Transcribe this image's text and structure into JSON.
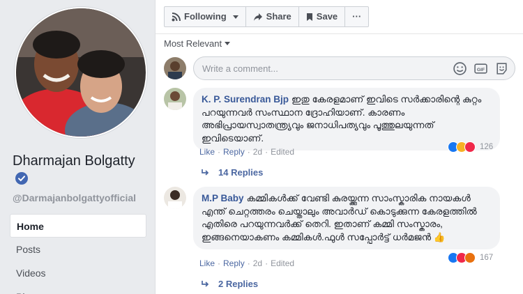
{
  "sidebar": {
    "page_name": "Dharmajan Bolgatty",
    "username": "@Darmajanbolgattyofficial",
    "nav": [
      "Home",
      "Posts",
      "Videos",
      "Ph..."
    ]
  },
  "actions": {
    "following": "Following",
    "share": "Share",
    "save": "Save",
    "more": "···"
  },
  "sort_label": "Most Relevant",
  "composer": {
    "placeholder": "Write a comment..."
  },
  "comments": [
    {
      "author": "K. P. Surendran Bjp",
      "text": "ഇതു കേരളമാണ് ഇവിടെ സർക്കാരിന്റെ കുറ്റം പറയുന്നവർ സംസ്ഥാന ദ്രോഹിയാണ്. കാരണം അഭിപ്രായസ്വാതന്ത്ര്യവും ജനാധിപത്യവും പൂത്തുലയുന്നത് ഇവിടെയാണ്.",
      "like": "Like",
      "reply": "Reply",
      "time": "2d",
      "edited": "Edited",
      "reaction_count": "126",
      "replies": "14 Replies"
    },
    {
      "author": "M.P Baby",
      "text": "കമ്മികൾക്ക് വേണ്ടി കുരയ്ക്കുന്ന സാംസ്കാരിക നായകൾ എന്ത് ചെറ്റത്തരം ചെയ്താലും അവാർഡ് കൊടുക്കുന്ന കേരളത്തിൽ എതിരെ പറയുന്നവർക്ക് തെറി. ഇതാണ് കമ്മി സംസ്കാരം, ഇങ്ങനെയാകണം കമ്മികൾ.ഫുൾ സപ്പോർട്ട് ധർമജൻ 👍",
      "like": "Like",
      "reply": "Reply",
      "time": "2d",
      "edited": "Edited",
      "reaction_count": "167",
      "replies": "2 Replies"
    }
  ],
  "colors": {
    "link": "#385898",
    "brand": "#4267b2",
    "bubble": "#f2f3f5"
  }
}
